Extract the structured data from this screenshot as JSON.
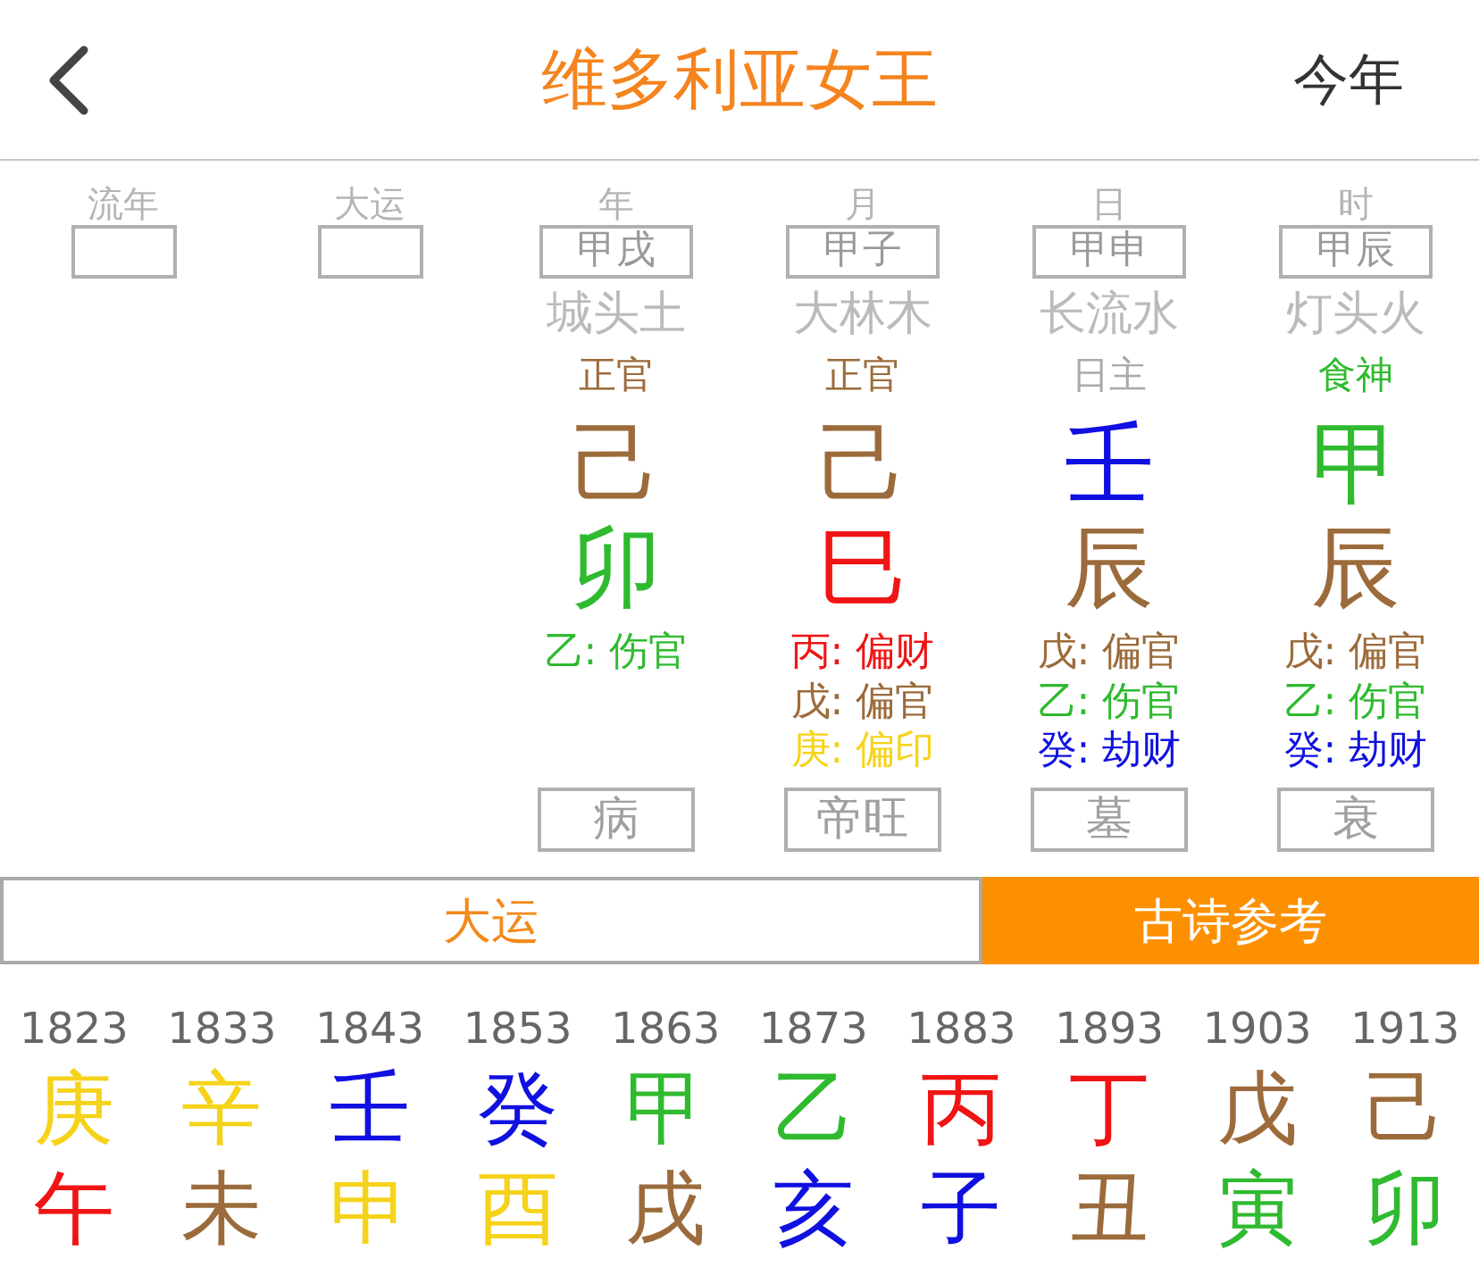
{
  "header": {
    "title": "维多利亚女王",
    "action": "今年"
  },
  "pillars": [
    {
      "kind": "blank",
      "label": "流年"
    },
    {
      "kind": "blank",
      "label": "大运"
    },
    {
      "kind": "pillar",
      "label": "年",
      "ganzhi": "甲戌",
      "nayin": "城头土",
      "ten_god": {
        "text": "正官",
        "color": "#9c6b3b"
      },
      "stem": {
        "text": "己",
        "color": "#9c6b3b"
      },
      "branch": {
        "text": "卯",
        "color": "#2fba2f"
      },
      "hidden": [
        {
          "text": "乙: 伤官",
          "color": "#2fba2f"
        }
      ],
      "stage": "病"
    },
    {
      "kind": "pillar",
      "label": "月",
      "ganzhi": "甲子",
      "nayin": "大林木",
      "ten_god": {
        "text": "正官",
        "color": "#9c6b3b"
      },
      "stem": {
        "text": "己",
        "color": "#9c6b3b"
      },
      "branch": {
        "text": "巳",
        "color": "#f01414"
      },
      "hidden": [
        {
          "text": "丙: 偏财",
          "color": "#f01414"
        },
        {
          "text": "戊: 偏官",
          "color": "#9c6b3b"
        },
        {
          "text": "庚: 偏印",
          "color": "#f5d31a"
        }
      ],
      "stage": "帝旺"
    },
    {
      "kind": "pillar",
      "label": "日",
      "ganzhi": "甲申",
      "nayin": "长流水",
      "ten_god": {
        "text": "日主",
        "color": "#aaaaaa"
      },
      "stem": {
        "text": "壬",
        "color": "#1010e0"
      },
      "branch": {
        "text": "辰",
        "color": "#9c6b3b"
      },
      "hidden": [
        {
          "text": "戊: 偏官",
          "color": "#9c6b3b"
        },
        {
          "text": "乙: 伤官",
          "color": "#2fba2f"
        },
        {
          "text": "癸: 劫财",
          "color": "#1010e0"
        }
      ],
      "stage": "墓"
    },
    {
      "kind": "pillar",
      "label": "时",
      "ganzhi": "甲辰",
      "nayin": "灯头火",
      "ten_god": {
        "text": "食神",
        "color": "#2fba2f"
      },
      "stem": {
        "text": "甲",
        "color": "#2fba2f"
      },
      "branch": {
        "text": "辰",
        "color": "#9c6b3b"
      },
      "hidden": [
        {
          "text": "戊: 偏官",
          "color": "#9c6b3b"
        },
        {
          "text": "乙: 伤官",
          "color": "#2fba2f"
        },
        {
          "text": "癸: 劫财",
          "color": "#1010e0"
        }
      ],
      "stage": "衰"
    }
  ],
  "section_bar": {
    "title": "大运",
    "button": "古诗参考"
  },
  "decades": [
    {
      "year": "1823",
      "stem": {
        "text": "庚",
        "color": "#f5d31a"
      },
      "branch": {
        "text": "午",
        "color": "#f01414"
      }
    },
    {
      "year": "1833",
      "stem": {
        "text": "辛",
        "color": "#f5d31a"
      },
      "branch": {
        "text": "未",
        "color": "#9c6b3b"
      }
    },
    {
      "year": "1843",
      "stem": {
        "text": "壬",
        "color": "#1010e0"
      },
      "branch": {
        "text": "申",
        "color": "#f5d31a"
      }
    },
    {
      "year": "1853",
      "stem": {
        "text": "癸",
        "color": "#1010e0"
      },
      "branch": {
        "text": "酉",
        "color": "#f5d31a"
      }
    },
    {
      "year": "1863",
      "stem": {
        "text": "甲",
        "color": "#2fba2f"
      },
      "branch": {
        "text": "戌",
        "color": "#9c6b3b"
      }
    },
    {
      "year": "1873",
      "stem": {
        "text": "乙",
        "color": "#2fba2f"
      },
      "branch": {
        "text": "亥",
        "color": "#1010e0"
      }
    },
    {
      "year": "1883",
      "stem": {
        "text": "丙",
        "color": "#f01414"
      },
      "branch": {
        "text": "子",
        "color": "#1010e0"
      }
    },
    {
      "year": "1893",
      "stem": {
        "text": "丁",
        "color": "#f01414"
      },
      "branch": {
        "text": "丑",
        "color": "#9c6b3b"
      }
    },
    {
      "year": "1903",
      "stem": {
        "text": "戊",
        "color": "#9c6b3b"
      },
      "branch": {
        "text": "寅",
        "color": "#2fba2f"
      }
    },
    {
      "year": "1913",
      "stem": {
        "text": "己",
        "color": "#9c6b3b"
      },
      "branch": {
        "text": "卯",
        "color": "#2fba2f"
      }
    }
  ]
}
